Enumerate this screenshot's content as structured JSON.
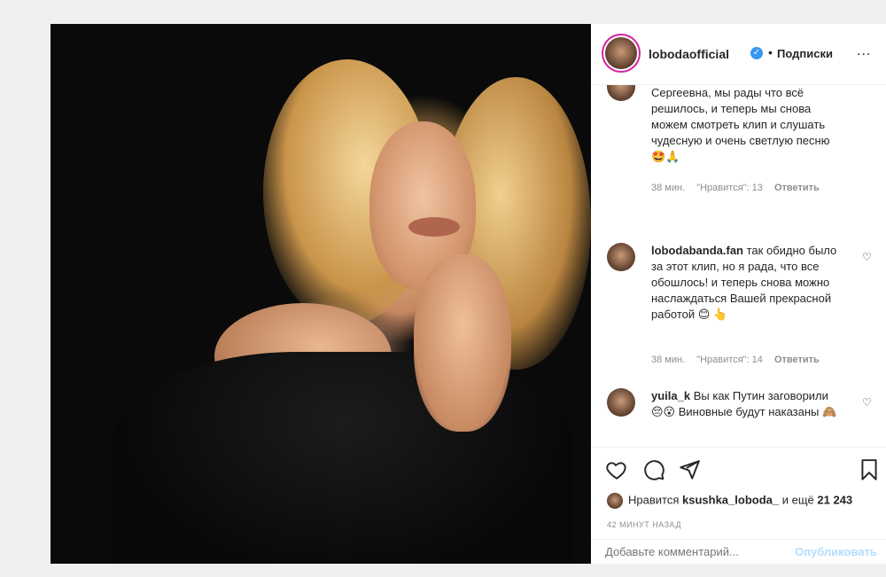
{
  "header": {
    "username": "lobodaofficial",
    "verified_glyph": "✓",
    "separator": "•",
    "follow_label": "Подписки",
    "more_label": "..."
  },
  "comments": [
    {
      "username": "",
      "text": "Сергеевна, мы рады что всё решилось, и теперь мы снова можем смотреть клип и слушать чудесную и очень светлую песню🤩🙏",
      "time": "38 мин.",
      "likes": "\"Нравится\": 13",
      "reply": "Ответить"
    },
    {
      "username": "lobodabanda.fan",
      "text": "так обидно было за этот клип, но я рада, что все обошлось! и теперь снова можно наслаждаться Вашей прекрасной работой 😊 👆",
      "time": "38 мин.",
      "likes": "\"Нравится\": 14",
      "reply": "Ответить"
    },
    {
      "username": "yuila_k",
      "text": "Вы как Путин заговорили 😔😮 Виновные будут наказаны 🙈",
      "time": "",
      "likes": "",
      "reply": ""
    }
  ],
  "actions": {
    "icons": [
      "heart-icon",
      "comment-icon",
      "share-icon",
      "bookmark-icon"
    ],
    "likes_prefix": "Нравится",
    "likes_user": "ksushka_loboda_",
    "likes_suffix": "и ещё",
    "likes_count": "21 243",
    "time": "42 МИНУТ НАЗАД",
    "comment_placeholder": "Добавьте комментарий...",
    "publish_label": "Опубликовать"
  },
  "colors": {
    "accent": "#3897f0",
    "publish_disabled": "#b2dffc",
    "muted_text": "#8e8e8e"
  }
}
